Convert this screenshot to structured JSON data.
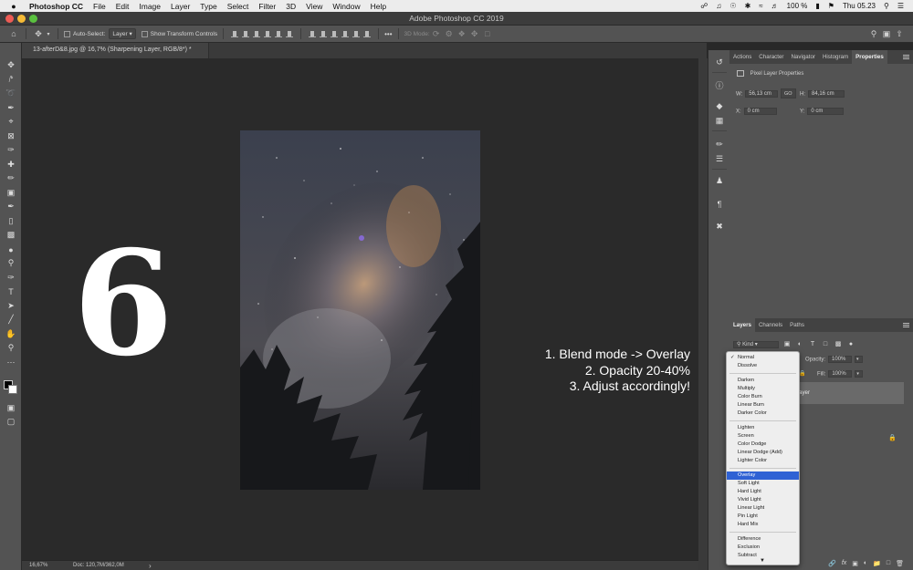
{
  "menubar": {
    "app_name": "Photoshop CC",
    "items": [
      "File",
      "Edit",
      "Image",
      "Layer",
      "Type",
      "Select",
      "Filter",
      "3D",
      "View",
      "Window",
      "Help"
    ],
    "battery": "100 %",
    "clock": "Thu 05.23"
  },
  "window": {
    "title": "Adobe Photoshop CC 2019"
  },
  "options": {
    "auto_select_label": "Auto-Select:",
    "auto_select_value": "Layer",
    "transform_label": "Show Transform Controls",
    "mode_3d_label": "3D Mode:",
    "more": "•••"
  },
  "document": {
    "tab_title": "13-afterD&8.jpg @ 16,7% (Sharpening Layer, RGB/8*) *",
    "step_number": "6",
    "steps": [
      "1. Blend mode -> Overlay",
      "2. Opacity 20-40%",
      "3. Adjust accordingly!"
    ],
    "zoom": "16,67%",
    "doc_size": "Doc: 120,7M/362,0M",
    "status_arrow": "›"
  },
  "properties": {
    "tabs": [
      "Actions",
      "Character",
      "Navigator",
      "Histogram",
      "Properties"
    ],
    "active_tab": "Properties",
    "header": "Pixel Layer Properties",
    "w_label": "W:",
    "w_value": "56,13 cm",
    "h_label": "H:",
    "h_value": "84,16 cm",
    "link_icon": "GO",
    "x_label": "X:",
    "x_value": "0 cm",
    "y_label": "Y:",
    "y_value": "0 cm"
  },
  "layers": {
    "tabs": [
      "Layers",
      "Channels",
      "Paths"
    ],
    "kind_filter": "Kind",
    "opacity_label": "Opacity:",
    "opacity_value": "100%",
    "fill_label": "Fill:",
    "fill_value": "100%",
    "layer_name_partial": "ayer",
    "footer_icons": [
      "link-icon",
      "fx-icon",
      "mask-icon",
      "adjustment-icon",
      "folder-icon",
      "new-layer-icon",
      "trash-icon"
    ]
  },
  "blend_menu": {
    "selected": "Overlay",
    "groups": [
      [
        "Normal",
        "Dissolve"
      ],
      [
        "Darken",
        "Multiply",
        "Color Burn",
        "Linear Burn",
        "Darker Color"
      ],
      [
        "Lighten",
        "Screen",
        "Color Dodge",
        "Linear Dodge (Add)",
        "Lighter Color"
      ],
      [
        "Overlay",
        "Soft Light",
        "Hard Light",
        "Vivid Light",
        "Linear Light",
        "Pin Light",
        "Hard Mix"
      ],
      [
        "Difference",
        "Exclusion",
        "Subtract"
      ]
    ],
    "checked": "Normal",
    "scroll_arrow": "▼"
  },
  "colors": {
    "accent": "#2f62d4",
    "panel": "#535353",
    "canvas": "#2a2a2a"
  }
}
